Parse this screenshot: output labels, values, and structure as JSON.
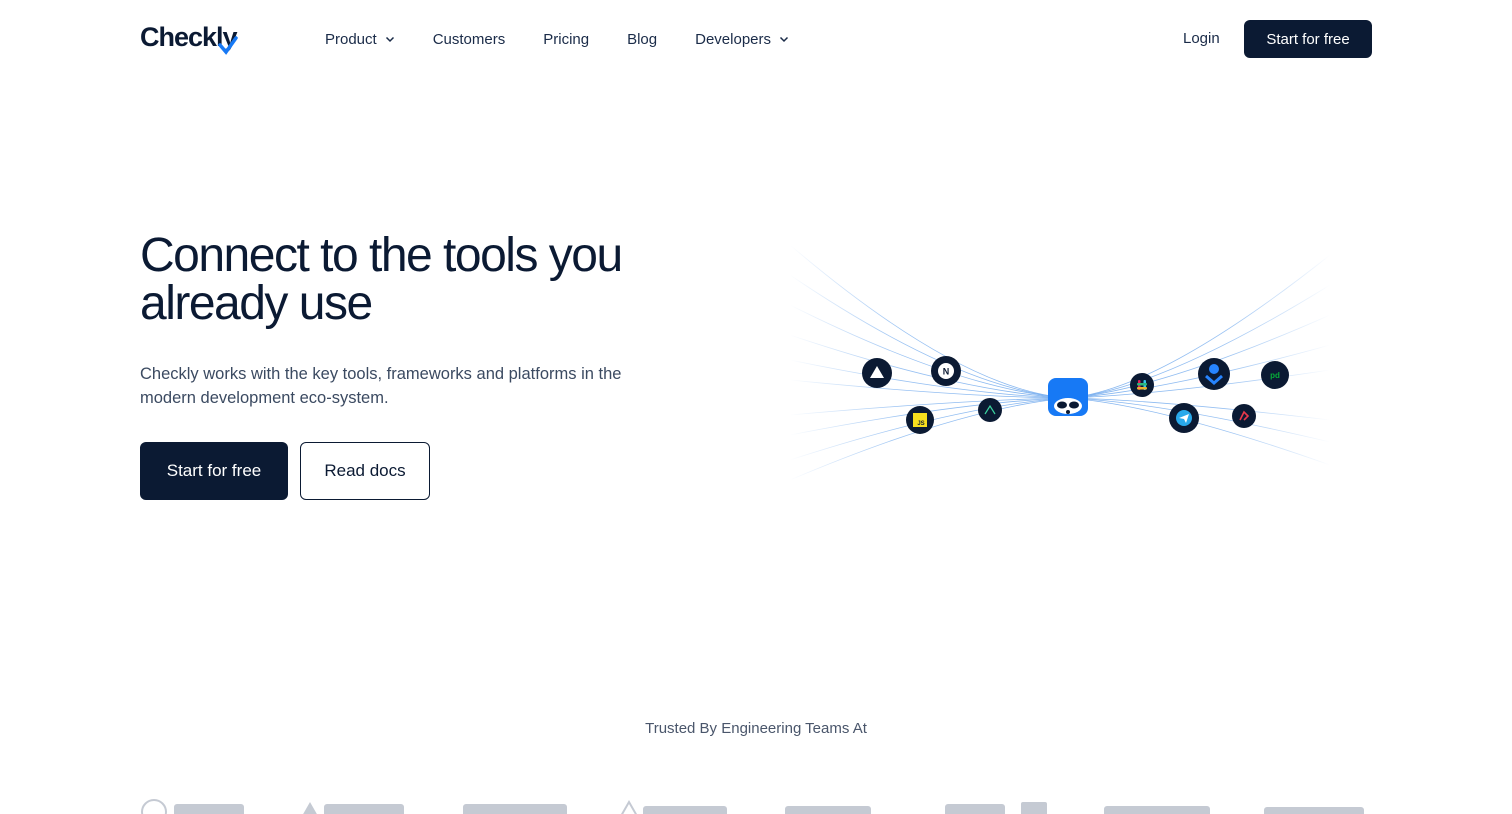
{
  "nav": {
    "logo_text": "Checkly",
    "links": [
      {
        "label": "Product",
        "dropdown": true
      },
      {
        "label": "Customers",
        "dropdown": false
      },
      {
        "label": "Pricing",
        "dropdown": false
      },
      {
        "label": "Blog",
        "dropdown": false
      },
      {
        "label": "Developers",
        "dropdown": true
      }
    ],
    "login_label": "Login",
    "cta_label": "Start for free"
  },
  "hero": {
    "title": "Connect to the tools you already use",
    "subtitle": "Checkly works with the key tools, frameworks and platforms in the modern development eco-system.",
    "primary_cta": "Start for free",
    "secondary_cta": "Read docs"
  },
  "illustration": {
    "center_icon": "raccoon-mascot-icon",
    "integration_icons": [
      "vercel-icon",
      "nextjs-icon",
      "javascript-icon",
      "nuxt-icon",
      "slack-icon",
      "opsgenie-icon",
      "pagerduty-icon",
      "telegram-icon",
      "rollbar-icon"
    ],
    "colors": {
      "center": "#1779f5",
      "line": "#7fb2ef",
      "icon_bg": "#0b1a33"
    }
  },
  "trusted": {
    "heading": "Trusted By Engineering Teams At"
  },
  "colors": {
    "primary": "#0b1a33",
    "accent": "#1779f5",
    "muted_logo": "#c5cad3"
  }
}
